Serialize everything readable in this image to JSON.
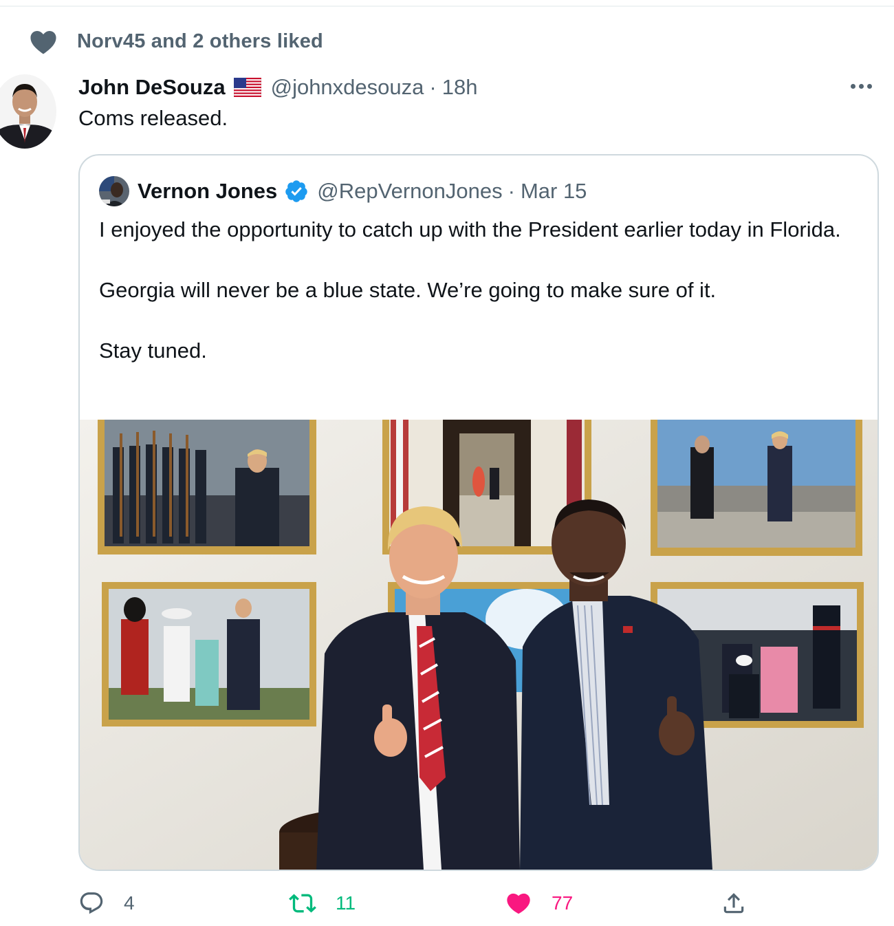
{
  "social_context": {
    "icon": "heart-icon",
    "text": "Norv45 and 2 others liked"
  },
  "tweet": {
    "author_name": "John DeSouza",
    "author_flag": "us-flag-emoji",
    "author_handle": "@johnxdesouza",
    "separator": "·",
    "time": "18h",
    "text": "Coms released."
  },
  "quoted_tweet": {
    "author_name": "Vernon Jones",
    "verified_icon": "verified-badge-icon",
    "author_handle": "@RepVernonJones",
    "separator": "·",
    "date": "Mar 15",
    "paragraphs": [
      "I enjoyed the opportunity to catch up with the President earlier today in Florida.",
      "Georgia will never be a blue state. We’re going to make sure of it.",
      "Stay tuned."
    ]
  },
  "actions": {
    "reply": {
      "icon": "reply-icon",
      "count": "4",
      "color": "#536471"
    },
    "retweet": {
      "icon": "retweet-icon",
      "count": "11",
      "color": "#00ba7c"
    },
    "like": {
      "icon": "heart-filled-icon",
      "count": "77",
      "color": "#f91880"
    },
    "share": {
      "icon": "share-icon",
      "color": "#536471"
    }
  },
  "colors": {
    "text": "#0f1419",
    "muted": "#536471",
    "border": "#cfd9de",
    "verified": "#1d9bf0"
  }
}
